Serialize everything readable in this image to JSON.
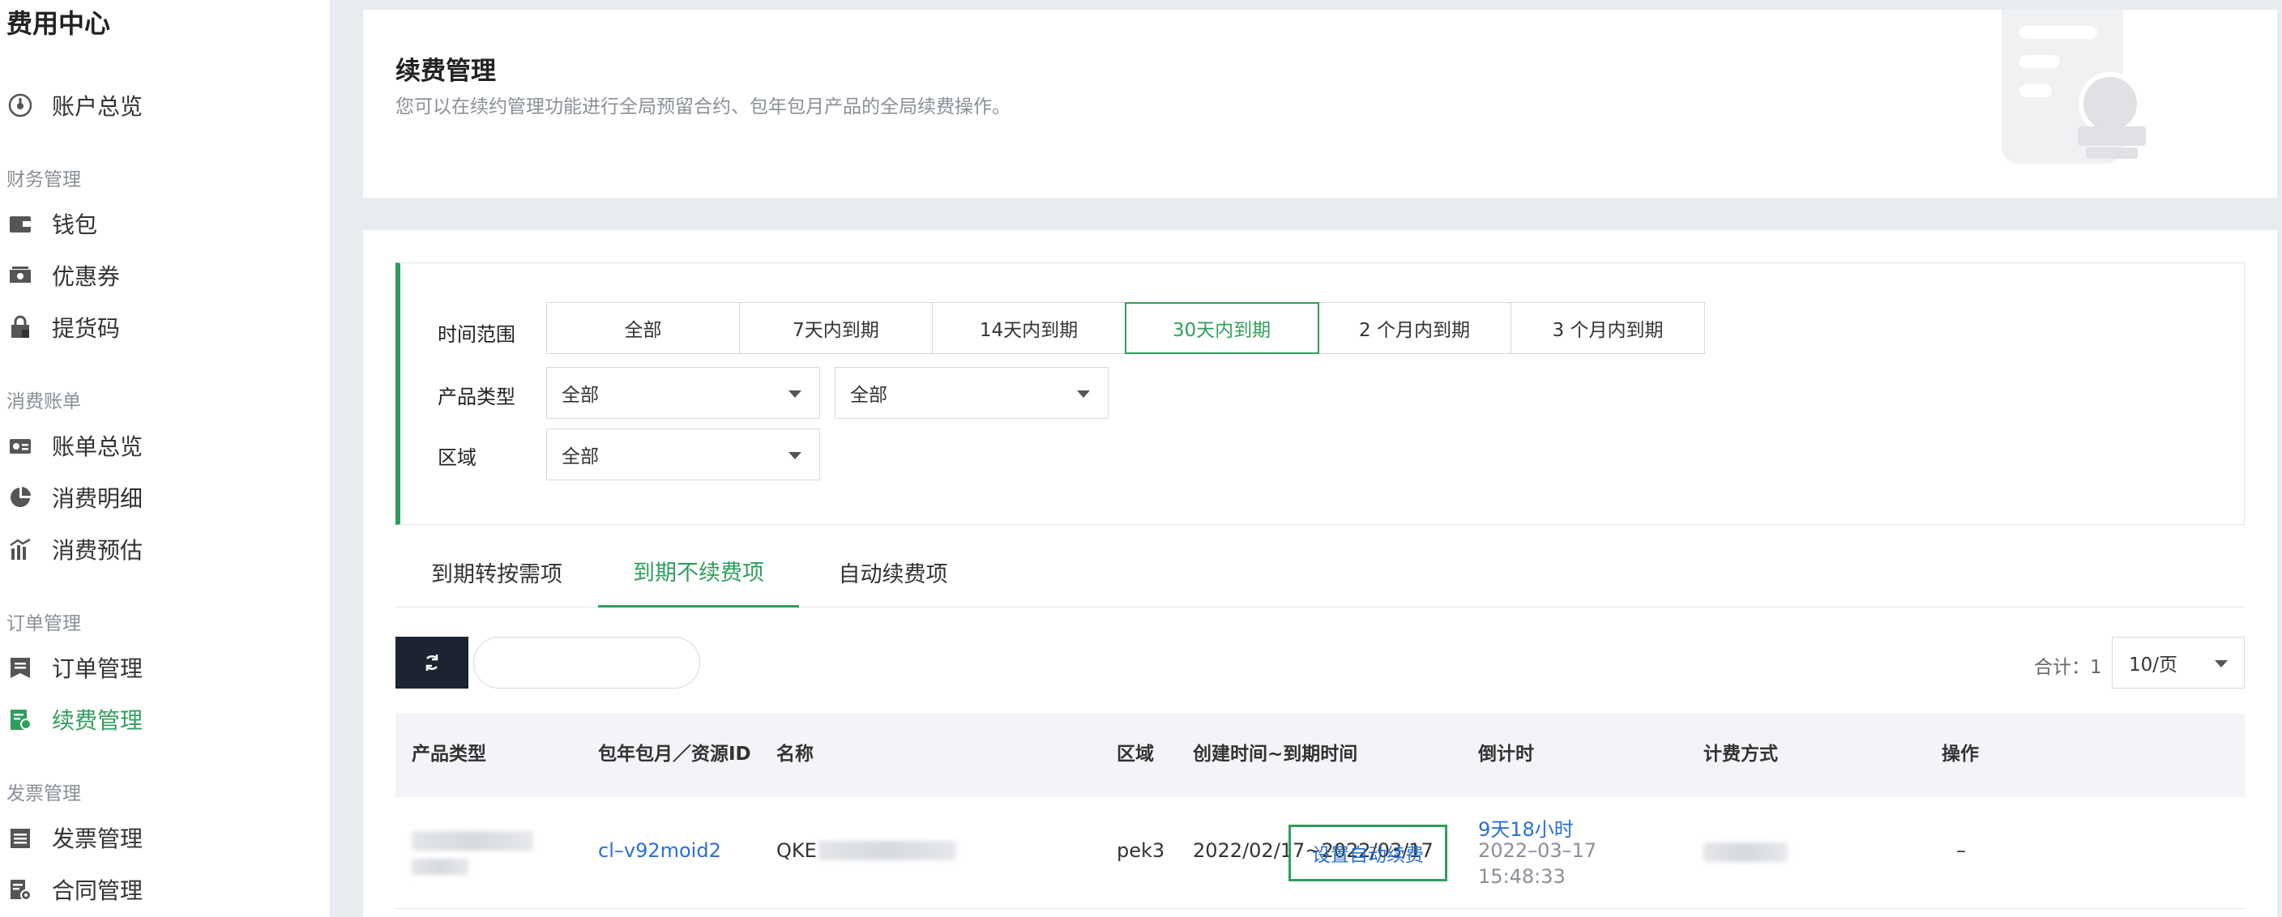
{
  "sidebar": {
    "title": "费用中心",
    "overview": {
      "label": "账户总览",
      "icon": "dashboard-icon"
    },
    "groups": {
      "finance": {
        "title": "财务管理",
        "items": [
          {
            "label": "钱包",
            "icon": "wallet-icon"
          },
          {
            "label": "优惠券",
            "icon": "coupon-icon"
          },
          {
            "label": "提货码",
            "icon": "lock-bag-icon"
          }
        ]
      },
      "billing": {
        "title": "消费账单",
        "items": [
          {
            "label": "账单总览",
            "icon": "bill-card-icon"
          },
          {
            "label": "消费明细",
            "icon": "pie-chart-icon"
          },
          {
            "label": "消费预估",
            "icon": "bar-chart-icon"
          }
        ]
      },
      "orders": {
        "title": "订单管理",
        "items": [
          {
            "label": "订单管理",
            "icon": "order-icon"
          },
          {
            "label": "续费管理",
            "icon": "renew-icon",
            "active": true
          }
        ]
      },
      "invoice": {
        "title": "发票管理",
        "items": [
          {
            "label": "发票管理",
            "icon": "invoice-icon"
          },
          {
            "label": "合同管理",
            "icon": "contract-gear-icon"
          }
        ]
      }
    }
  },
  "header": {
    "title": "续费管理",
    "description": "您可以在续约管理功能进行全局预留合约、包年包月产品的全局续费操作。"
  },
  "filters": {
    "time_range": {
      "label": "时间范围",
      "options": [
        "全部",
        "7天内到期",
        "14天内到期",
        "30天内到期",
        "2 个月内到期",
        "3 个月内到期"
      ],
      "selected": "30天内到期"
    },
    "product_type": {
      "label": "产品类型",
      "select1": "全部",
      "select2": "全部"
    },
    "region": {
      "label": "区域",
      "select": "全部"
    }
  },
  "tabs": [
    "到期转按需项",
    "到期不续费项",
    "自动续费项"
  ],
  "active_tab": "到期不续费项",
  "toolbar": {
    "refresh_icon": "refresh-icon",
    "search_placeholder": "",
    "total_label": "合计：1",
    "page_size": "10/页"
  },
  "table": {
    "headers": {
      "product_type": "产品类型",
      "resource_id": "包年包月／资源ID",
      "name": "名称",
      "region": "区域",
      "time": "创建时间~到期时间",
      "countdown": "倒计时",
      "billing": "计费方式",
      "action": "操作"
    },
    "rows": [
      {
        "resource_id": "cl–v92moid2",
        "name_prefix": "QKE",
        "region": "pek3",
        "time": "2022/02/17~2022/03/17",
        "countdown": "9天18小时",
        "expire_date": "2022–03–17",
        "expire_time": "15:48:33",
        "dash": "–",
        "action_label": "设置自动续费"
      }
    ]
  },
  "colors": {
    "accent": "#2f9e5c",
    "link": "#2a6fd6",
    "dark_button": "#1b2430"
  }
}
